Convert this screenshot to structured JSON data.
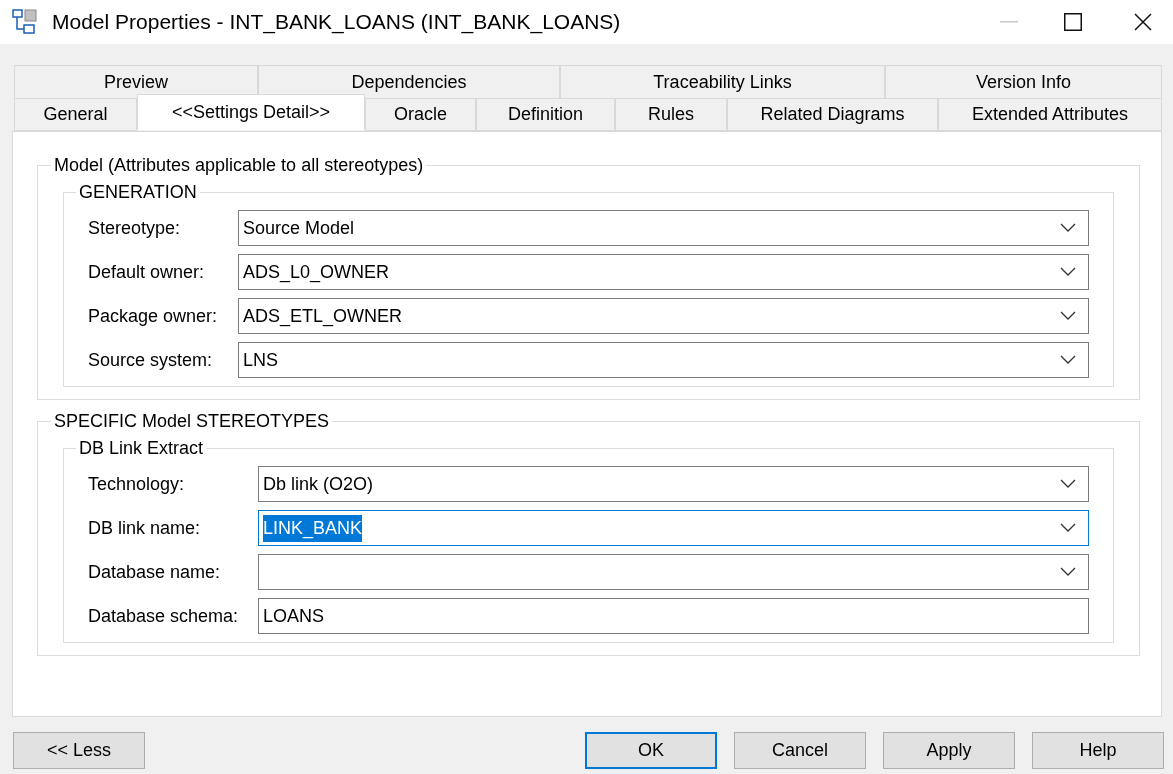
{
  "window": {
    "title": "Model Properties - INT_BANK_LOANS (INT_BANK_LOANS)",
    "minimize_disabled": true
  },
  "tab_rows": [
    [
      {
        "label": "Preview",
        "selected": false
      },
      {
        "label": "Dependencies",
        "selected": false
      },
      {
        "label": "Traceability Links",
        "selected": false
      },
      {
        "label": "Version Info",
        "selected": false
      }
    ],
    [
      {
        "label": "General",
        "selected": false
      },
      {
        "label": "<<Settings Detail>>",
        "selected": true
      },
      {
        "label": "Oracle",
        "selected": false
      },
      {
        "label": "Definition",
        "selected": false
      },
      {
        "label": "Rules",
        "selected": false
      },
      {
        "label": "Related Diagrams",
        "selected": false
      },
      {
        "label": "Extended Attributes",
        "selected": false
      }
    ]
  ],
  "groups": [
    {
      "title": "Model (Attributes applicable to all stereotypes)",
      "subgroup": {
        "title": "GENERATION",
        "fields": [
          {
            "label": "Stereotype:",
            "value": "Source Model",
            "kind": "combo",
            "focused": false
          },
          {
            "label": "Default owner:",
            "value": "ADS_L0_OWNER",
            "kind": "combo",
            "focused": false
          },
          {
            "label": "Package owner:",
            "value": "ADS_ETL_OWNER",
            "kind": "combo",
            "focused": false
          },
          {
            "label": "Source system:",
            "value": "LNS",
            "kind": "combo",
            "focused": false
          }
        ]
      }
    },
    {
      "title": "SPECIFIC Model STEREOTYPES",
      "subgroup": {
        "title": "DB Link Extract",
        "fields": [
          {
            "label": "Technology:",
            "value": "Db link (O2O)",
            "kind": "combo",
            "focused": false
          },
          {
            "label": "DB link name:",
            "value": "LINK_BANK",
            "kind": "combo",
            "focused": true
          },
          {
            "label": "Database name:",
            "kind": "combo",
            "focused": false
          },
          {
            "label": "Database schema:",
            "value": "LOANS",
            "kind": "text",
            "focused": false
          }
        ]
      }
    }
  ],
  "buttons": [
    {
      "label": "<< Less",
      "default": false
    },
    {
      "label": "OK",
      "default": true
    },
    {
      "label": "Cancel",
      "default": false
    },
    {
      "label": "Apply",
      "default": false
    },
    {
      "label": "Help",
      "default": false
    }
  ]
}
